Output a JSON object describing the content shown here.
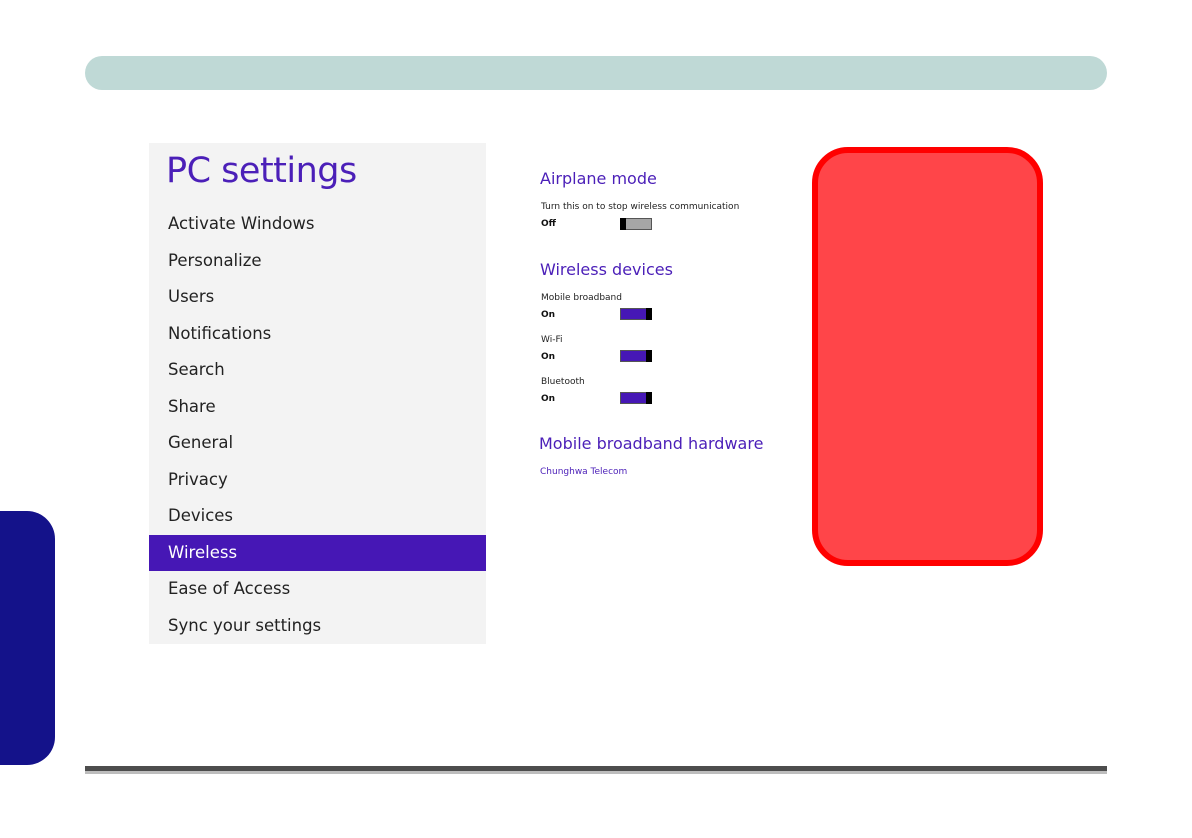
{
  "window": {
    "title": "PC settings"
  },
  "nav": {
    "items": [
      {
        "label": "Activate Windows",
        "selected": false
      },
      {
        "label": "Personalize",
        "selected": false
      },
      {
        "label": "Users",
        "selected": false
      },
      {
        "label": "Notifications",
        "selected": false
      },
      {
        "label": "Search",
        "selected": false
      },
      {
        "label": "Share",
        "selected": false
      },
      {
        "label": "General",
        "selected": false
      },
      {
        "label": "Privacy",
        "selected": false
      },
      {
        "label": "Devices",
        "selected": false
      },
      {
        "label": "Wireless",
        "selected": true
      },
      {
        "label": "Ease of Access",
        "selected": false
      },
      {
        "label": "Sync your settings",
        "selected": false
      }
    ]
  },
  "airplane": {
    "heading": "Airplane mode",
    "description": "Turn this on to stop wireless communication",
    "state": "Off"
  },
  "wireless_devices": {
    "heading": "Wireless devices",
    "devices": [
      {
        "name": "Mobile broadband",
        "state": "On"
      },
      {
        "name": "Wi-Fi",
        "state": "On"
      },
      {
        "name": "Bluetooth",
        "state": "On"
      }
    ]
  },
  "hardware": {
    "heading": "Mobile broadband hardware",
    "link": "Chunghwa Telecom"
  },
  "colors": {
    "accent": "#4617b5",
    "top_bar": "#bfd9d6",
    "side_tab": "#14128a",
    "callout_fill": "#ff4549",
    "callout_border": "#ff0000"
  }
}
